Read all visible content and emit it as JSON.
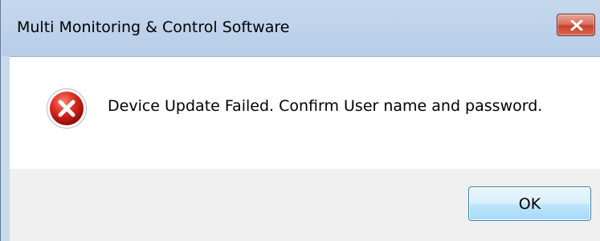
{
  "window": {
    "title": "Multi Monitoring & Control Software"
  },
  "message": {
    "text": "Device Update Failed. Confirm User name and password.",
    "icon": "error-icon"
  },
  "buttons": {
    "ok_label": "OK",
    "close_icon": "close-icon"
  },
  "colors": {
    "close_button": "#c9422c",
    "error_icon": "#d9251c",
    "ok_button_border": "#3c7fb1"
  }
}
